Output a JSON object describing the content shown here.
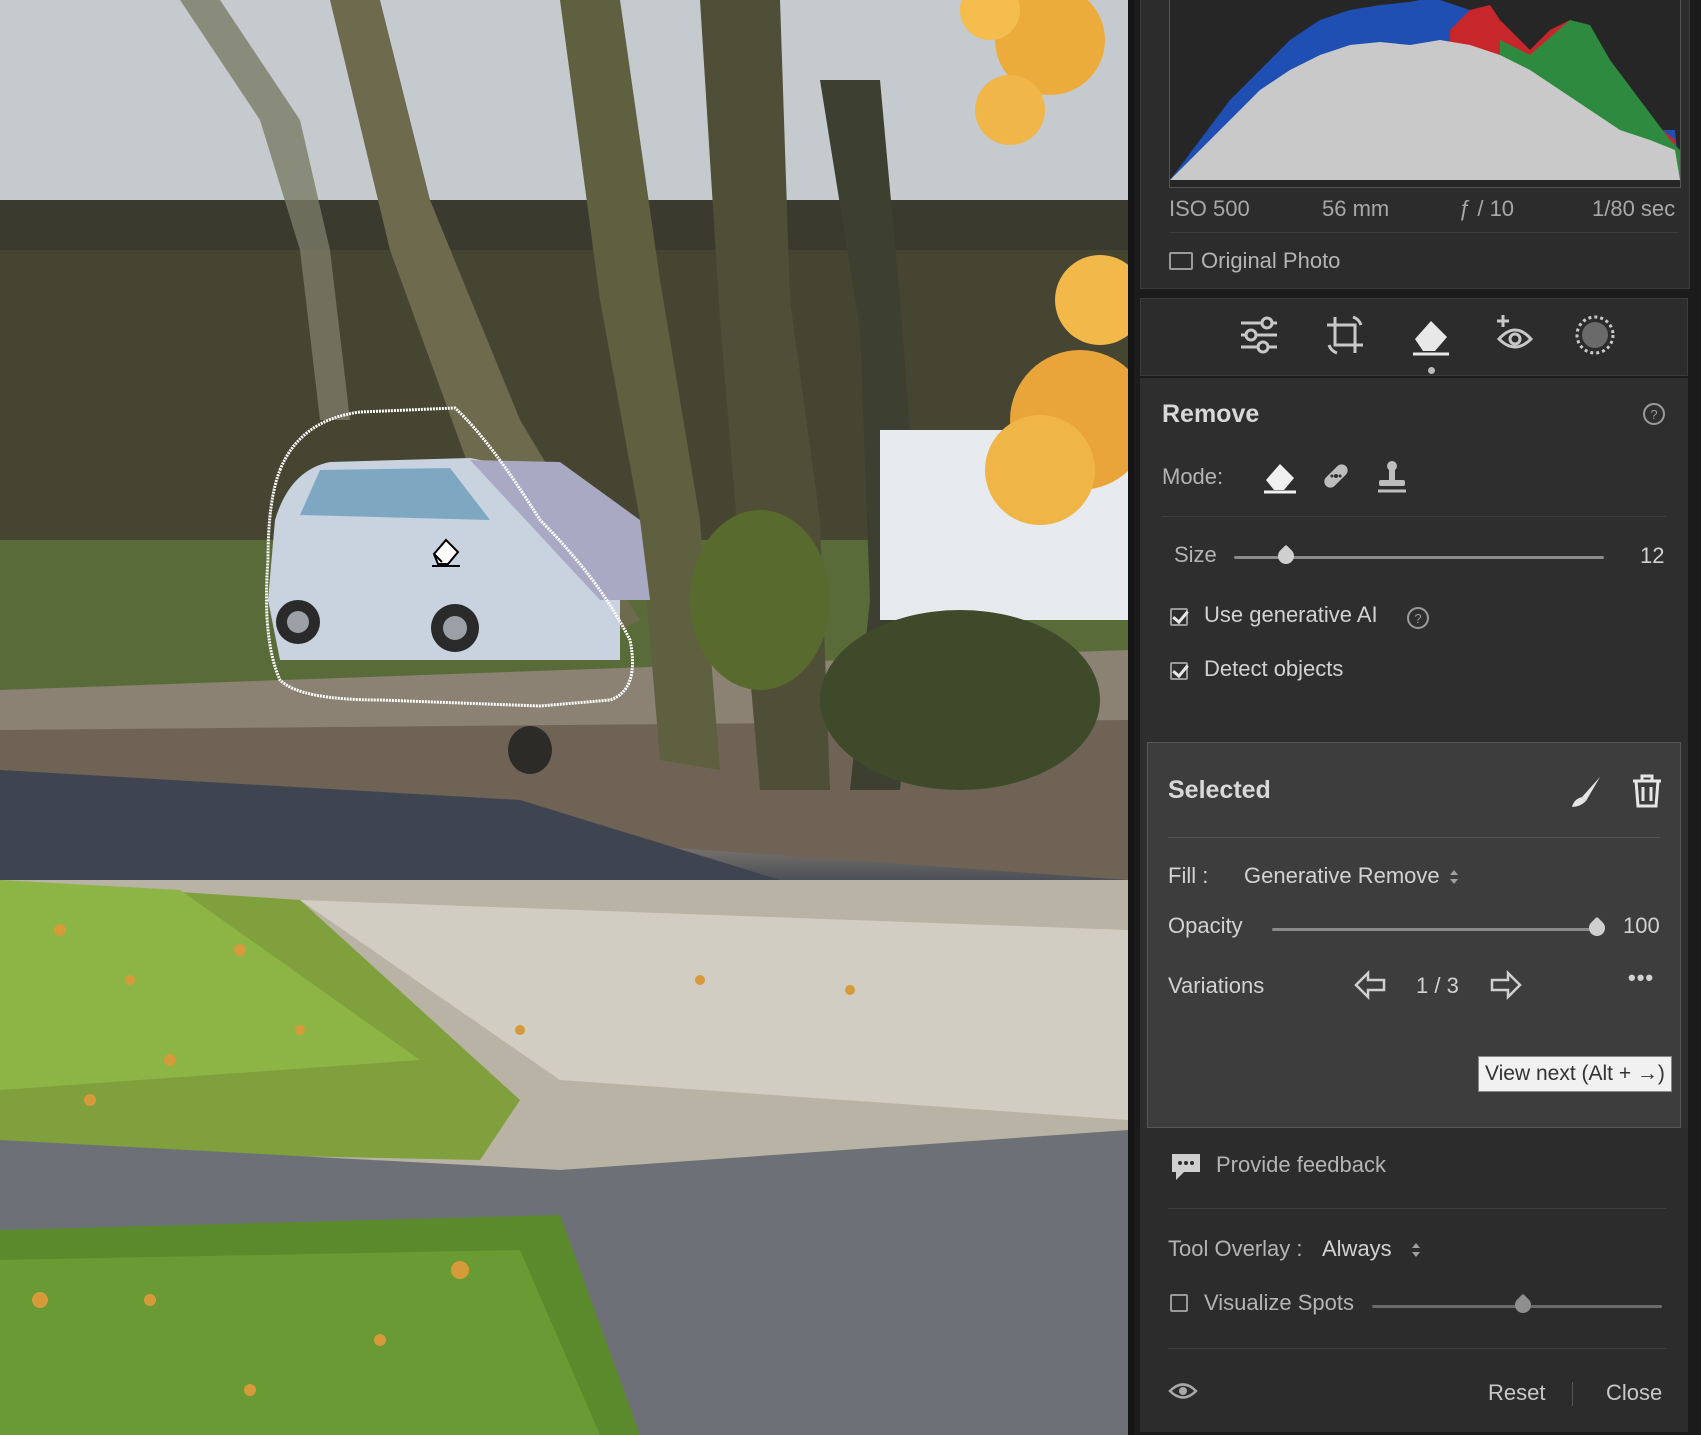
{
  "histogram": {
    "iso": "ISO 500",
    "focal_length": "56 mm",
    "aperture": "ƒ / 10",
    "shutter": "1/80 sec"
  },
  "original_photo": {
    "label": "Original Photo",
    "checked": false
  },
  "toolbar": {
    "tools": [
      "edit-sliders-icon",
      "crop-icon",
      "remove-eraser-icon",
      "red-eye-icon",
      "masking-icon"
    ],
    "active_tool": "remove-eraser-icon"
  },
  "remove_panel": {
    "title": "Remove",
    "mode_label": "Mode:",
    "modes": [
      "remove-eraser-icon",
      "heal-bandage-icon",
      "clone-stamp-icon"
    ],
    "active_mode": "remove-eraser-icon",
    "size_label": "Size",
    "size_value": "12",
    "size_fraction": 0.14,
    "use_generative_ai": {
      "label": "Use generative AI",
      "checked": true
    },
    "detect_objects": {
      "label": "Detect objects",
      "checked": true
    }
  },
  "selected_panel": {
    "title": "Selected",
    "fill_label": "Fill :",
    "fill_value": "Generative Remove",
    "opacity_label": "Opacity",
    "opacity_value": "100",
    "opacity_fraction": 1.0,
    "variations_label": "Variations",
    "variations_value": "1 / 3",
    "more_label": "•••"
  },
  "tooltip": "View next (Alt + →)",
  "feedback": {
    "label": "Provide feedback"
  },
  "tool_overlay": {
    "label": "Tool Overlay :",
    "value": "Always"
  },
  "visualize_spots": {
    "label": "Visualize Spots",
    "checked": false,
    "fraction": 0.52
  },
  "footer": {
    "reset_label": "Reset",
    "close_label": "Close"
  },
  "colors": {
    "panel_bg": "#2e2e2e",
    "selected_bg": "#3d3d3d",
    "text": "#d6d6d6"
  }
}
